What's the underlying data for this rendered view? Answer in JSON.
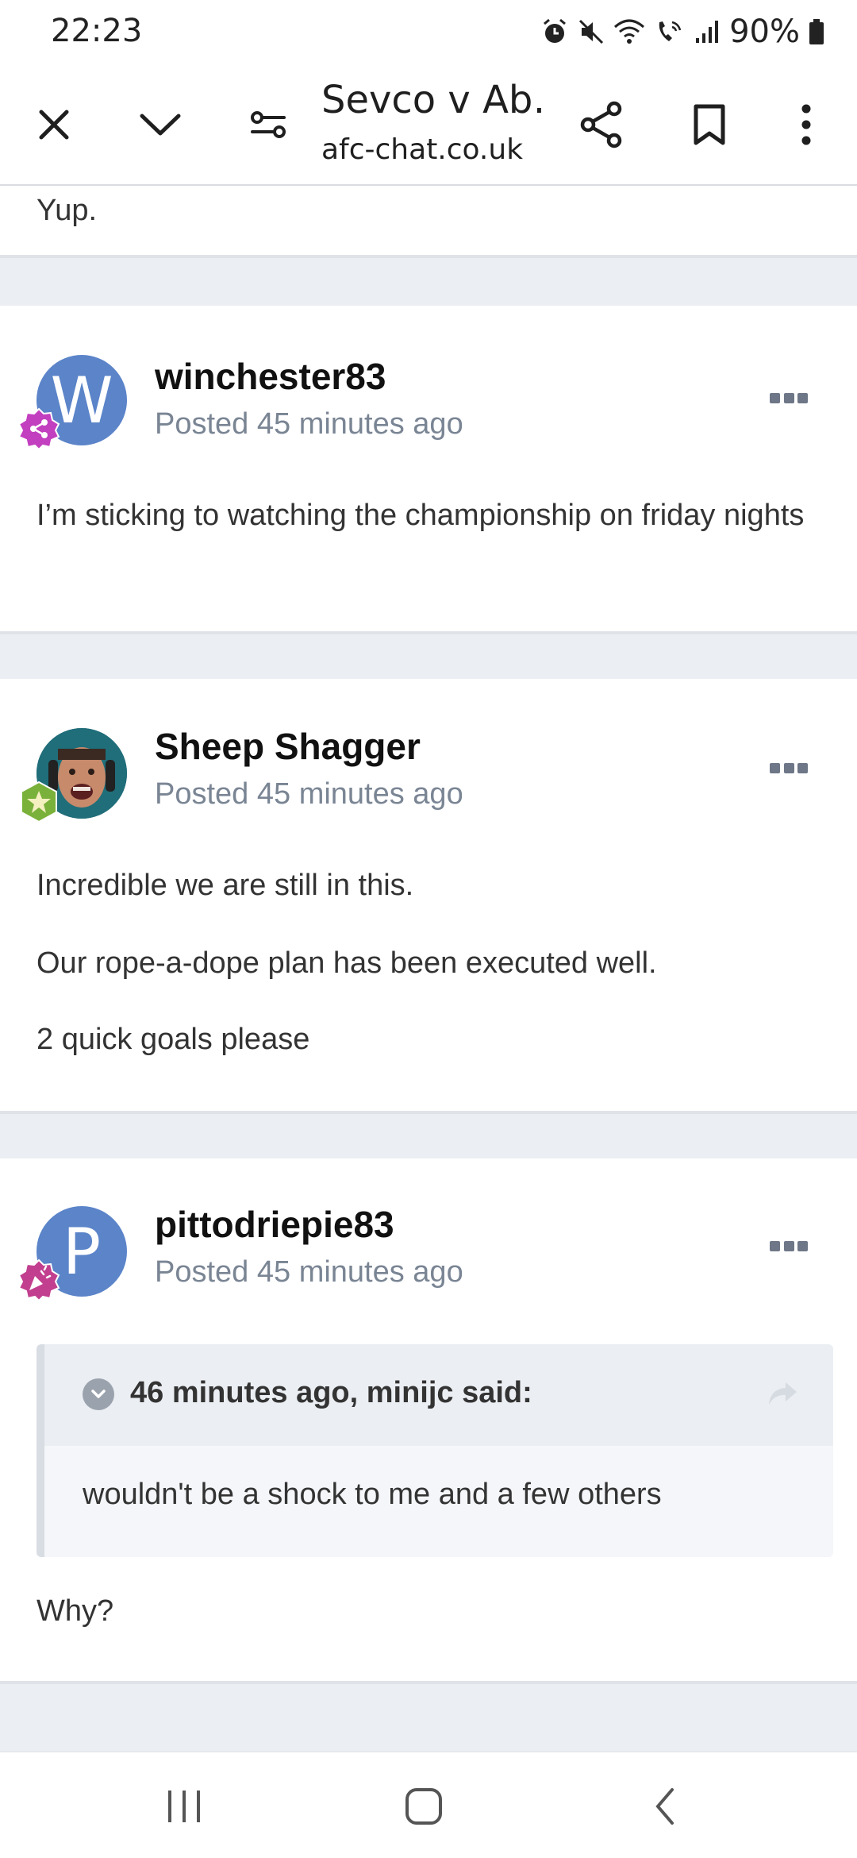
{
  "status_bar": {
    "time": "22:23",
    "battery": "90%",
    "icons": [
      "alarm-icon",
      "mute-icon",
      "wifi-icon",
      "wifi-calling-icon",
      "signal-icon",
      "battery-icon"
    ]
  },
  "toolbar": {
    "title": "Sevco v Ab…",
    "url": "afc-chat.co.uk",
    "icons": [
      "close-icon",
      "chevron-down-icon",
      "page-controls-icon",
      "share-icon",
      "bookmark-icon",
      "more-vert-icon"
    ]
  },
  "prev_post": {
    "text": "Yup."
  },
  "posts": [
    {
      "author": "winchester83",
      "meta": "Posted 45 minutes ago",
      "avatar_letter": "W",
      "avatar_color": "#5b84c9",
      "badge_color": "#c23fbf",
      "paragraphs": [
        "I’m sticking to watching the championship on friday nights"
      ]
    },
    {
      "author": "Sheep Shagger",
      "meta": "Posted 45 minutes ago",
      "avatar_letter": "",
      "badge_color": "#7ab13a",
      "paragraphs": [
        "Incredible we are still in this.",
        "Our rope-a-dope plan has been executed well.",
        "2 quick goals please"
      ]
    },
    {
      "author": "pittodriepie83",
      "meta": "Posted 45 minutes ago",
      "avatar_letter": "P",
      "avatar_color": "#5b84c9",
      "badge_color": "#c23f8f",
      "quote": {
        "header": "46 minutes ago, minijc said:",
        "text": "wouldn't be a shock to me and a few others"
      },
      "paragraphs": [
        "Why?"
      ]
    }
  ],
  "colors": {
    "background": "#ebeef2",
    "meta_text": "#7a8594",
    "accent_avatar": "#5b84c9"
  },
  "nav_bar": {
    "icons": [
      "recent-apps-icon",
      "home-icon",
      "back-icon"
    ]
  }
}
